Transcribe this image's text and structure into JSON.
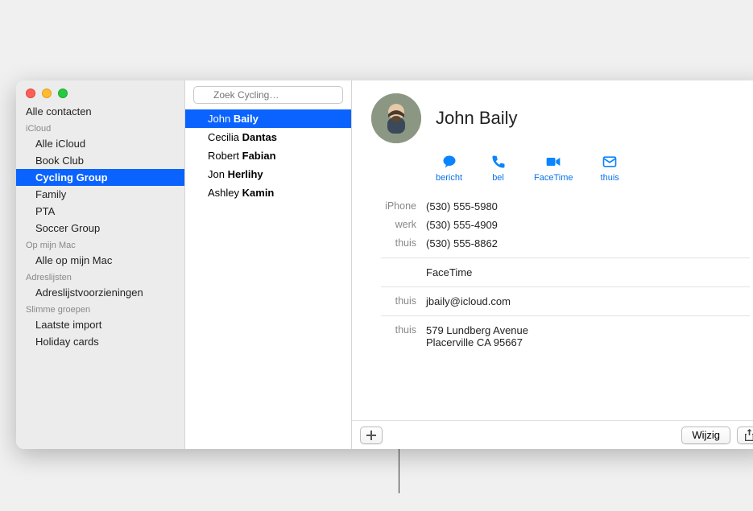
{
  "sidebar": {
    "top": "Alle contacten",
    "sections": [
      {
        "header": "iCloud",
        "items": [
          "Alle iCloud",
          "Book Club",
          "Cycling Group",
          "Family",
          "PTA",
          "Soccer Group"
        ],
        "selectedIndex": 2
      },
      {
        "header": "Op mijn Mac",
        "items": [
          "Alle op mijn Mac"
        ]
      },
      {
        "header": "Adreslijsten",
        "items": [
          "Adreslijstvoorzieningen"
        ]
      },
      {
        "header": "Slimme groepen",
        "items": [
          "Laatste import",
          "Holiday cards"
        ]
      }
    ]
  },
  "search": {
    "placeholder": "Zoek Cycling…"
  },
  "contacts": [
    {
      "first": "John",
      "last": "Baily",
      "selected": true
    },
    {
      "first": "Cecilia",
      "last": "Dantas"
    },
    {
      "first": "Robert",
      "last": "Fabian"
    },
    {
      "first": "Jon",
      "last": "Herlihy"
    },
    {
      "first": "Ashley",
      "last": "Kamin"
    }
  ],
  "card": {
    "name": "John Baily",
    "actions": [
      {
        "id": "bericht",
        "label": "bericht"
      },
      {
        "id": "bel",
        "label": "bel"
      },
      {
        "id": "facetime",
        "label": "FaceTime"
      },
      {
        "id": "thuis",
        "label": "thuis"
      }
    ],
    "phones": [
      {
        "label": "iPhone",
        "value": "(530) 555-5980"
      },
      {
        "label": "werk",
        "value": "(530) 555-4909"
      },
      {
        "label": "thuis",
        "value": "(530) 555-8862"
      }
    ],
    "facetime_label": "FaceTime",
    "email": {
      "label": "thuis",
      "value": "jbaily@icloud.com"
    },
    "address": {
      "label": "thuis",
      "line1": "579 Lundberg Avenue",
      "line2": "Placerville CA 95667"
    }
  },
  "buttons": {
    "edit": "Wijzig"
  },
  "colors": {
    "accent": "#0a72e8",
    "selection": "#0a63ff"
  }
}
